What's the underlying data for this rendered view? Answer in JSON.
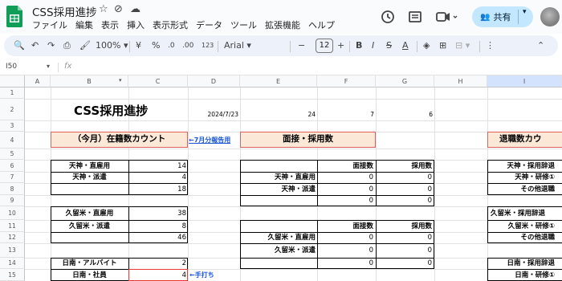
{
  "app": {
    "title": "CSS採用進捗",
    "menu": [
      "ファイル",
      "編集",
      "表示",
      "挿入",
      "表示形式",
      "データ",
      "ツール",
      "拡張機能",
      "ヘルプ"
    ],
    "share_label": "共有"
  },
  "toolbar": {
    "zoom": "100%",
    "currency": "¥",
    "percent": "%",
    "dec_less": ".0",
    "dec_more": ".00",
    "number_format": "123",
    "font": "Arial",
    "font_size": "12"
  },
  "formula": {
    "namebox": "I50",
    "fx": "fx"
  },
  "columns": [
    "A",
    "B",
    "C",
    "D",
    "E",
    "F",
    "G",
    "H",
    "I"
  ],
  "rows": [
    "1",
    "2",
    "3",
    "4",
    "5",
    "6",
    "7",
    "8",
    "9",
    "10",
    "11",
    "12",
    "13",
    "14",
    "15"
  ],
  "sheet": {
    "title": "CSS採用進捗",
    "date": "2024/7/23",
    "e2": "24",
    "f2": "7",
    "g2": "6",
    "sec1_header": "（今月）在籍数カウント",
    "sec1_note": "←7月分報告用",
    "sec2_header": "面接・採用数",
    "sec3_header": "退職数カウ",
    "r6b": "天神・直雇用",
    "r6c": "14",
    "r7b": "天神・派遣",
    "r7c": "4",
    "r8c": "18",
    "r10b": "久留米・直雇用",
    "r10c": "38",
    "r11b": "久留米・派遣",
    "r11c": "8",
    "r12c": "46",
    "r14b": "日南・アルバイト",
    "r14c": "2",
    "r15b": "日南・社員",
    "r15c": "4",
    "r15note": "←手打ち",
    "mid_col_f": "面接数",
    "mid_col_g": "採用数",
    "r7e": "天神・直雇用",
    "r8e": "天神・派遣",
    "zero": "0",
    "r12e": "久留米・直雇用",
    "r13e": "久留米・派遣",
    "r6i": "天神・採用辞退",
    "r7i": "天神・研修①",
    "r8i": "その他退職",
    "r10i": "久留米・採用辞退",
    "r11i": "久留米・研修①",
    "r12i": "その他退職",
    "r14i": "日南・採用辞退",
    "r15i": "日南・研修①"
  },
  "colors": {
    "accent": "#0b57d0",
    "header_fill": "#fce8d6",
    "header_border": "#e06060",
    "note": "#1a56db",
    "share_bg": "#c2e7ff"
  }
}
